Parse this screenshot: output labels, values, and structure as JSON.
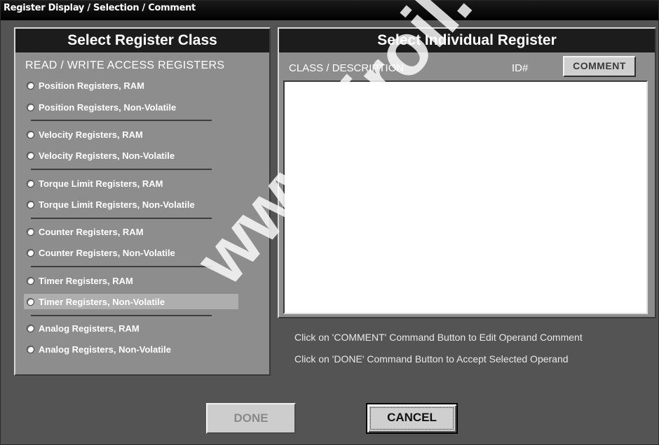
{
  "window": {
    "title": "Register Display / Selection / Comment"
  },
  "left_panel": {
    "title": "Select Register Class",
    "section_label": "READ / WRITE ACCESS REGISTERS",
    "options": [
      "Position Registers, RAM",
      "Position Registers, Non-Volatile",
      "Velocity Registers, RAM",
      "Velocity Registers, Non-Volatile",
      "Torque Limit Registers, RAM",
      "Torque Limit Registers, Non-Volatile",
      "Counter Registers, RAM",
      "Counter Registers, Non-Volatile",
      "Timer Registers, RAM",
      "Timer Registers, Non-Volatile",
      "Analog Registers, RAM",
      "Analog Registers, Non-Volatile"
    ],
    "selected_option": "Timer Registers, Non-Volatile"
  },
  "right_panel": {
    "title": "Select Individual Register",
    "col_class": "CLASS / DESCRIPTION",
    "col_id": "ID#",
    "comment_button": "COMMENT",
    "hint_comment": "Click on 'COMMENT' Command Button to Edit Operand Comment",
    "hint_done": "Click on 'DONE' Command Button to Accept Selected Operand"
  },
  "buttons": {
    "done": "DONE",
    "cancel": "CANCEL"
  },
  "watermark": "www.airoil.com"
}
